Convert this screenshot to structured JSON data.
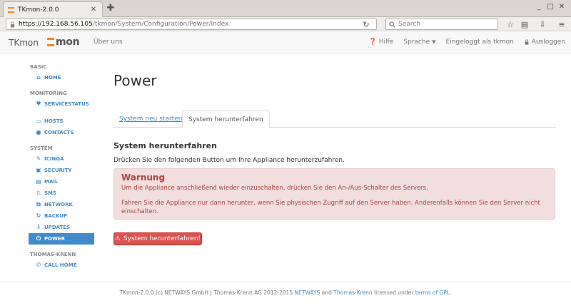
{
  "browser": {
    "tab_title": "TKmon-2.0.0",
    "tab_close": "✕",
    "new_tab": "✚",
    "url_host": "https://192.168.56.105",
    "url_path": "/tkmon/System/Configuration/Power/Index",
    "search_placeholder": "Search",
    "window_controls": [
      "_",
      "□",
      "✕"
    ]
  },
  "header": {
    "brand": "TKmon",
    "logo_text": "mon",
    "about": "Über uns",
    "help": "Hilfe",
    "language": "Sprache",
    "logged_in": "Eingeloggt als tkmon",
    "logout": "Ausloggen"
  },
  "sidebar": {
    "sections": [
      {
        "title": "BASIC",
        "items": [
          {
            "label": "HOME",
            "icon": "home-icon",
            "glyph": "⌂",
            "active": false
          }
        ]
      },
      {
        "title": "MONITORING",
        "items": [
          {
            "label": "SERVICESTATUS",
            "icon": "heart-icon",
            "glyph": "♥",
            "active": false
          },
          {
            "label": "HOSTS",
            "icon": "monitor-icon",
            "glyph": "▭",
            "active": false
          },
          {
            "label": "CONTACTS",
            "icon": "user-icon",
            "glyph": "●",
            "active": false
          }
        ]
      },
      {
        "title": "SYSTEM",
        "items": [
          {
            "label": "ICINGA",
            "icon": "wrench-icon",
            "glyph": "✎",
            "active": false
          },
          {
            "label": "SECURITY",
            "icon": "lock-icon",
            "glyph": "▣",
            "active": false
          },
          {
            "label": "MAIL",
            "icon": "inbox-icon",
            "glyph": "▤",
            "active": false
          },
          {
            "label": "SMS",
            "icon": "phone-icon",
            "glyph": "▯",
            "active": false
          },
          {
            "label": "NETWORK",
            "icon": "sitemap-icon",
            "glyph": "⧉",
            "active": false
          },
          {
            "label": "BACKUP",
            "icon": "refresh-icon",
            "glyph": "↻",
            "active": false
          },
          {
            "label": "UPDATES",
            "icon": "download-icon",
            "glyph": "⇩",
            "active": false
          },
          {
            "label": "POWER",
            "icon": "power-icon",
            "glyph": "⏻",
            "active": true
          }
        ]
      },
      {
        "title": "THOMAS-KRENN",
        "items": [
          {
            "label": "CALL HOME",
            "icon": "phone-call-icon",
            "glyph": "✆",
            "active": false
          }
        ]
      }
    ]
  },
  "main": {
    "title": "Power",
    "tabs": [
      "System neu starten",
      "System herunterfahren"
    ],
    "section_title": "System herunterfahren",
    "description": "Drücken Sie den folgenden Button um Ihre Appliance herunterzufahren.",
    "alert": {
      "title": "Warnung",
      "line1": "Um die Appliance anschließend wieder einzuschalten, drücken Sie den An-/Aus-Schalter des Servers.",
      "line2": "Fahren Sie die Appliance nur dann herunter, wenn Sie physischen Zugriff auf den Server haben. Anderenfalls können Sie den Server nicht einschalten."
    },
    "button": "System herunterfahren!"
  },
  "footer": {
    "prefix": "TKmon-2.0.0 (c) NETWAYS GmbH | Thomas-Krenn.AG 2012-2015",
    "netways": "NETWAYS",
    "and": "and",
    "thomas": "Thomas-Krenn",
    "licensed": "licensed under",
    "gpl": "terms of GPL",
    "end": "."
  },
  "colors": {
    "accent": "#428bca",
    "danger": "#d9534f",
    "alert_bg": "#f2dede",
    "alert_text": "#a94442",
    "logo_orange": "#f28a1c"
  }
}
